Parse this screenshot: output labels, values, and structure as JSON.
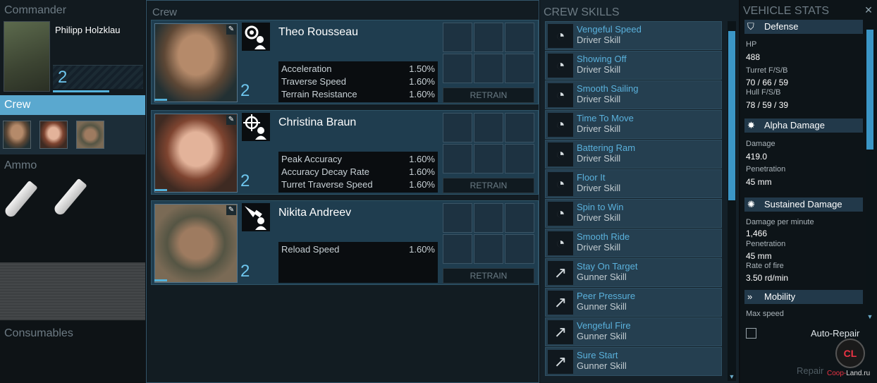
{
  "commander": {
    "section_title": "Commander",
    "name": "Philipp Holzklau",
    "level": "2"
  },
  "crew_tab": {
    "label": "Crew"
  },
  "ammo": {
    "section_title": "Ammo"
  },
  "consumables": {
    "section_title": "Consumables"
  },
  "center": {
    "title": "Crew",
    "members": [
      {
        "name": "Theo Rousseau",
        "level": "2",
        "role_icon": "driver-gear-icon",
        "stats": [
          {
            "label": "Acceleration",
            "value": "1.50%"
          },
          {
            "label": "Traverse Speed",
            "value": "1.60%"
          },
          {
            "label": "Terrain Resistance",
            "value": "1.60%"
          }
        ],
        "retrain_label": "RETRAIN"
      },
      {
        "name": "Christina Braun",
        "level": "2",
        "role_icon": "gunner-crosshair-icon",
        "stats": [
          {
            "label": "Peak Accuracy",
            "value": "1.60%"
          },
          {
            "label": "Accuracy Decay Rate",
            "value": "1.60%"
          },
          {
            "label": "Turret Traverse Speed",
            "value": "1.60%"
          }
        ],
        "retrain_label": "RETRAIN"
      },
      {
        "name": "Nikita Andreev",
        "level": "2",
        "role_icon": "loader-shell-icon",
        "stats": [
          {
            "label": "Reload Speed",
            "value": "1.60%"
          }
        ],
        "retrain_label": "RETRAIN"
      }
    ]
  },
  "skills": {
    "title": "CREW SKILLS",
    "items": [
      {
        "name": "Vengeful Speed",
        "type": "Driver Skill",
        "icon": "speedometer-icon"
      },
      {
        "name": "Showing Off",
        "type": "Driver Skill",
        "icon": "speedometer-icon"
      },
      {
        "name": "Smooth Sailing",
        "type": "Driver Skill",
        "icon": "speedometer-icon"
      },
      {
        "name": "Time To Move",
        "type": "Driver Skill",
        "icon": "speedometer-icon"
      },
      {
        "name": "Battering Ram",
        "type": "Driver Skill",
        "icon": "speedometer-icon"
      },
      {
        "name": "Floor It",
        "type": "Driver Skill",
        "icon": "speedometer-icon"
      },
      {
        "name": "Spin to Win",
        "type": "Driver Skill",
        "icon": "speedometer-icon"
      },
      {
        "name": "Smooth Ride",
        "type": "Driver Skill",
        "icon": "speedometer-icon"
      },
      {
        "name": "Stay On Target",
        "type": "Gunner Skill",
        "icon": "turret-arrow-icon"
      },
      {
        "name": "Peer Pressure",
        "type": "Gunner Skill",
        "icon": "turret-arrow-icon"
      },
      {
        "name": "Vengeful Fire",
        "type": "Gunner Skill",
        "icon": "turret-arrow-icon"
      },
      {
        "name": "Sure Start",
        "type": "Gunner Skill",
        "icon": "turret-arrow-icon"
      }
    ]
  },
  "vehicle_stats": {
    "title": "VEHICLE STATS",
    "defense": {
      "header": "Defense",
      "hp_label": "HP",
      "hp_value": "488",
      "turret_label": "Turret F/S/B",
      "turret_value": "70 / 66 / 59",
      "hull_label": "Hull F/S/B",
      "hull_value": "78 / 59 / 39"
    },
    "alpha": {
      "header": "Alpha Damage",
      "damage_label": "Damage",
      "damage_value": "419.0",
      "pen_label": "Penetration",
      "pen_value": "45 mm"
    },
    "sustained": {
      "header": "Sustained Damage",
      "dpm_label": "Damage per minute",
      "dpm_value": "1,466",
      "pen_label": "Penetration",
      "pen_value": "45 mm",
      "rof_label": "Rate of fire",
      "rof_value": "3.50 rd/min"
    },
    "mobility": {
      "header": "Mobility",
      "maxspeed_label": "Max speed"
    },
    "auto_repair_label": "Auto-Repair",
    "repair_label": "Repair",
    "watermark": {
      "brand": "Coop-",
      "rest": "Land.ru",
      "logo": "CL"
    }
  }
}
